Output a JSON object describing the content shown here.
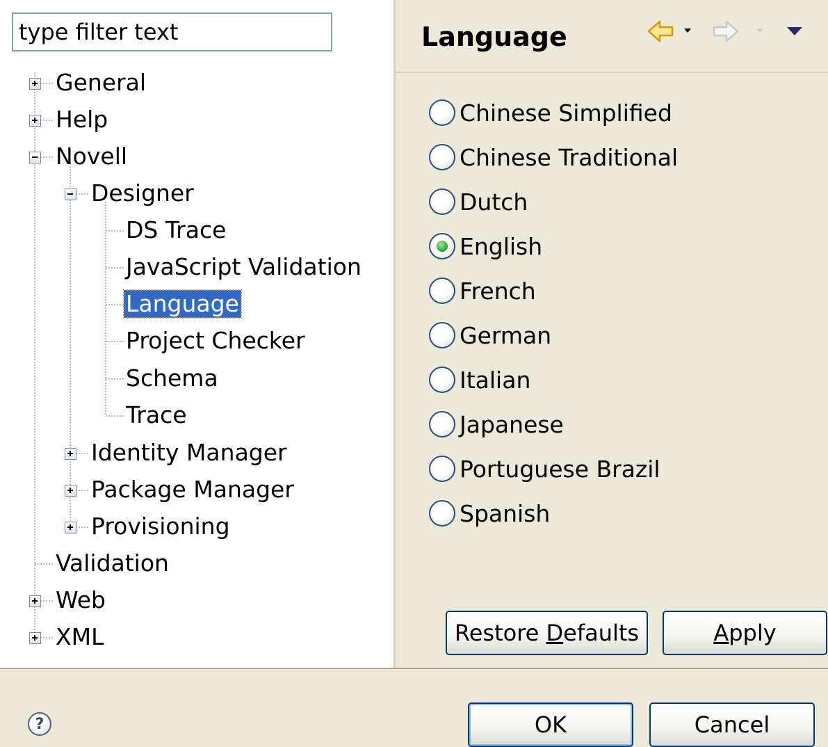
{
  "filter": {
    "placeholder": "type filter text"
  },
  "tree": {
    "items": [
      {
        "label": "General",
        "expander": "plus"
      },
      {
        "label": "Help",
        "expander": "plus"
      },
      {
        "label": "Novell",
        "expander": "minus"
      },
      {
        "label": "Designer",
        "expander": "minus"
      },
      {
        "label": "DS Trace"
      },
      {
        "label": "JavaScript Validation"
      },
      {
        "label": "Language",
        "selected": true
      },
      {
        "label": "Project Checker"
      },
      {
        "label": "Schema"
      },
      {
        "label": "Trace"
      },
      {
        "label": "Identity Manager",
        "expander": "plus"
      },
      {
        "label": "Package Manager",
        "expander": "plus"
      },
      {
        "label": "Provisioning",
        "expander": "plus"
      },
      {
        "label": "Validation"
      },
      {
        "label": "Web",
        "expander": "plus"
      },
      {
        "label": "XML",
        "expander": "plus"
      }
    ]
  },
  "page": {
    "title": "Language",
    "nav_icons": [
      "back-arrow-icon",
      "back-dropdown-icon",
      "forward-arrow-icon",
      "forward-dropdown-icon",
      "view-menu-icon"
    ]
  },
  "languages": {
    "selected": "English",
    "options": [
      "Chinese Simplified",
      "Chinese Traditional",
      "Dutch",
      "English",
      "French",
      "German",
      "Italian",
      "Japanese",
      "Portuguese Brazil",
      "Spanish"
    ]
  },
  "buttons": {
    "restore_defaults": {
      "pre": "Restore ",
      "mnemonic": "D",
      "post": "efaults"
    },
    "apply": {
      "pre": "",
      "mnemonic": "A",
      "post": "pply"
    },
    "ok": "OK",
    "cancel": "Cancel",
    "help": "?"
  },
  "colors": {
    "selection": "#316ac5",
    "radio_checked": "#21a121",
    "panel_bg": "#ece9d8",
    "button_border": "#003c74",
    "back_arrow": "#f0b000"
  }
}
